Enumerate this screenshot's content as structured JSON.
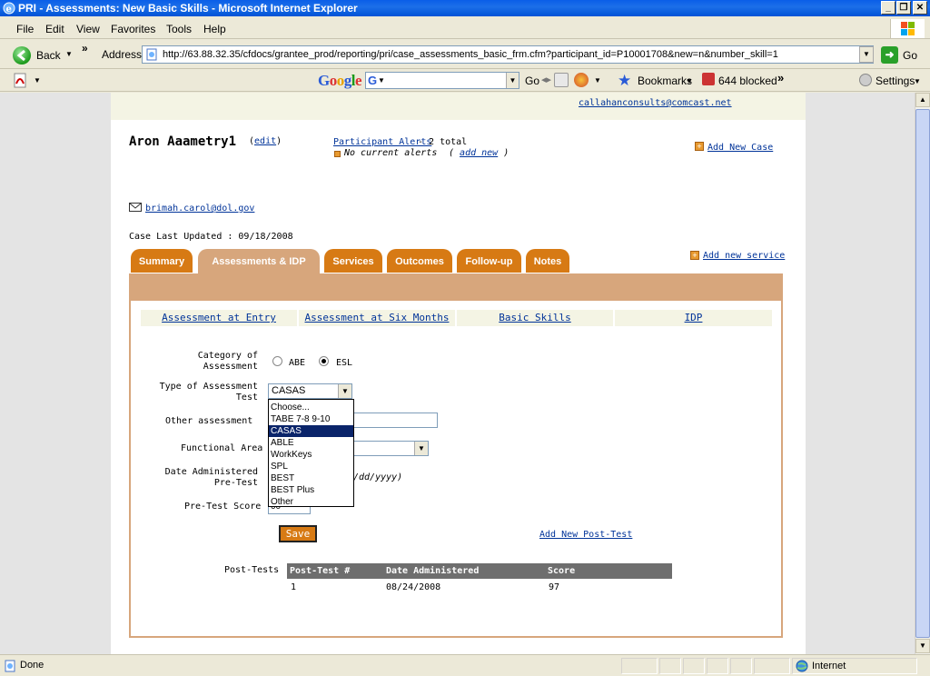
{
  "window": {
    "title": "PRI - Assessments: New Basic Skills - Microsoft Internet Explorer",
    "min_glyph": "_",
    "max_glyph": "❐",
    "close_glyph": "✕"
  },
  "menubar": {
    "items": [
      "File",
      "Edit",
      "View",
      "Favorites",
      "Tools",
      "Help"
    ]
  },
  "addressbar": {
    "back_label": "Back",
    "more_glyph": "»",
    "address_label": "Address",
    "url": "http://63.88.32.35/cfdocs/grantee_prod/reporting/pri/case_assessments_basic_frm.cfm?participant_id=P10001708&new=n&number_skill=1",
    "go_label": "Go"
  },
  "google_toolbar": {
    "logo": "Google",
    "go_label": "Go",
    "bookmarks_label": "Bookmarks",
    "blocked_label": "644 blocked",
    "more_glyph": "»",
    "settings_label": "Settings"
  },
  "page": {
    "top_email": "callahanconsults@comcast.net",
    "participant_name": "Aron Aaametry1",
    "edit_link": "edit",
    "alerts_link": "Participant Alerts",
    "alerts_total": " - 2 total",
    "no_alerts": "No current alerts",
    "add_new_alert": "add new",
    "add_new_case": "Add New Case",
    "contact_email": "brimah.carol@dol.gov",
    "case_last_updated": "Case Last Updated : 09/18/2008",
    "add_new_service": "Add new service",
    "tabs": [
      "Summary",
      "Assessments & IDP",
      "Services",
      "Outcomes",
      "Follow-up",
      "Notes"
    ],
    "active_tab": "Assessments & IDP",
    "subtabs": [
      "Assessment at Entry",
      "Assessment at Six Months",
      "Basic Skills",
      "IDP"
    ],
    "form": {
      "category_label_1": "Category of",
      "category_label_2": "Assessment",
      "category_options": [
        "ABE",
        "ESL"
      ],
      "category_selected": "ESL",
      "type_label_1": "Type of Assessment",
      "type_label_2": "Test",
      "type_value": "CASAS",
      "type_options": [
        "Choose...",
        "TABE 7-8 9-10",
        "CASAS",
        "ABLE",
        "WorkKeys",
        "SPL",
        "BEST",
        "BEST Plus",
        "Other"
      ],
      "other_label": "Other assessment",
      "functional_label": "Functional Area",
      "date_label_1": "Date Administered",
      "date_label_2": "Pre-Test",
      "date_hint": "/dd/yyyy)",
      "score_label": "Pre-Test Score",
      "score_value": "00",
      "save_label": "Save",
      "add_post_test": "Add New Post-Test"
    },
    "post_tests": {
      "label": "Post-Tests",
      "headers": [
        "Post-Test #",
        "Date Administered",
        "Score"
      ],
      "rows": [
        {
          "num": "1",
          "date": "08/24/2008",
          "score": "97"
        }
      ]
    }
  },
  "statusbar": {
    "status": "Done",
    "zone": "Internet"
  }
}
